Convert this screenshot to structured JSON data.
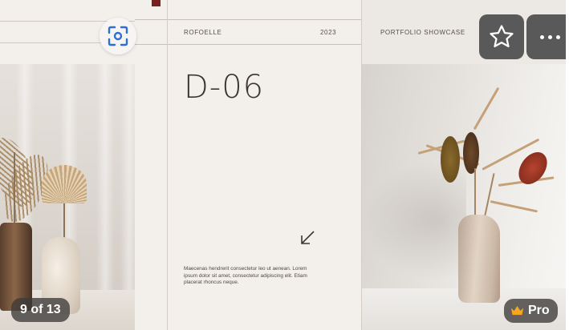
{
  "slideshow": {
    "counter": "9 of 13",
    "badge_label": "Pro",
    "colors": {
      "badge_crown": "#f5a623",
      "overlay_button": "#444446",
      "top_marker": "#7a1f1f",
      "scan_icon": "#2d6fd6"
    }
  },
  "template": {
    "brand": "ROFOELLE",
    "year": "2023",
    "section": "PORTFOLIO SHOWCASE",
    "code": "D-06",
    "body_text": "Maecenas hendrerit consectetur leo ut aenean. Lorem ipsum dolor sit amet, consectetur adipiscing elit. Etiam placerat rhoncus neque."
  },
  "icons": {
    "scan": "scan-icon",
    "star": "star-icon",
    "more": "more-icon",
    "crown": "crown-icon",
    "arrow": "arrow-down-left-icon"
  }
}
